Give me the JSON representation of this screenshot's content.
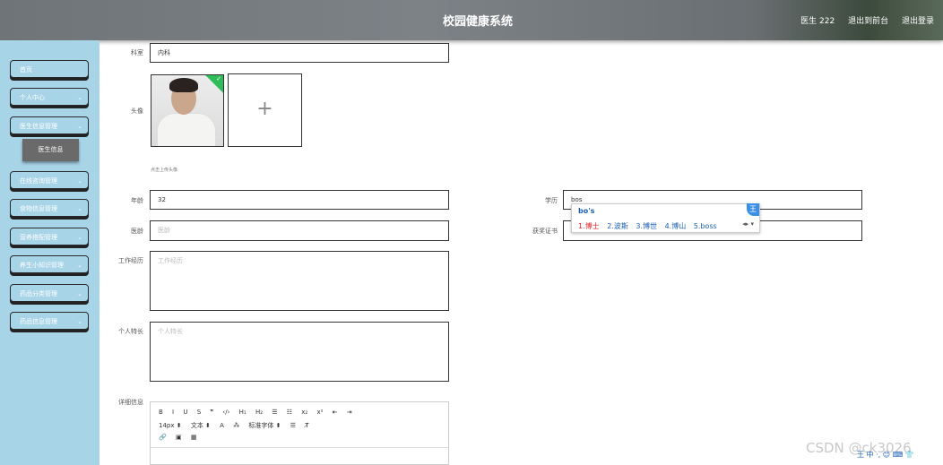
{
  "header": {
    "title": "校园健康系统",
    "user": "医生 222",
    "back_label": "退出到前台",
    "logout_label": "退出登录"
  },
  "sidebar": {
    "items": [
      {
        "label": "首页",
        "chevron": ""
      },
      {
        "label": "个人中心",
        "chevron": "⌄"
      },
      {
        "label": "医生信息管理",
        "chevron": "⌄"
      },
      {
        "label": "在线咨询管理",
        "chevron": "⌄"
      },
      {
        "label": "食物信息管理",
        "chevron": "⌄"
      },
      {
        "label": "营养搭配管理",
        "chevron": "⌄"
      },
      {
        "label": "养生小知识管理",
        "chevron": "⌄"
      },
      {
        "label": "药品分类管理",
        "chevron": "⌄"
      },
      {
        "label": "药品信息管理",
        "chevron": "⌄"
      }
    ],
    "submenu_label": "医生信息"
  },
  "form": {
    "department": {
      "label": "科室",
      "value": "内科"
    },
    "avatar": {
      "label": "头像",
      "plus": "+",
      "hint": "点击上传头像"
    },
    "age": {
      "label": "年龄",
      "value": "32"
    },
    "education": {
      "label": "学历",
      "value": "bos"
    },
    "work_years": {
      "label": "医龄",
      "placeholder": "医龄"
    },
    "certificate": {
      "label": "获奖证书",
      "placeholder": "获奖证书"
    },
    "experience": {
      "label": "工作经历",
      "placeholder": "工作经历"
    },
    "specialty": {
      "label": "个人特长",
      "placeholder": "个人特长"
    },
    "detail": {
      "label": "详细信息"
    }
  },
  "ime": {
    "composition": "bo's",
    "candidates": [
      "1.博士",
      "2.波斯",
      "3.博世",
      "4.博山",
      "5.boss"
    ],
    "arrows": "◂▸ ▾",
    "logo": "王"
  },
  "editor": {
    "row1": [
      "B",
      "I",
      "U",
      "S",
      "❞",
      "‹/›",
      "H₁",
      "H₂",
      "☰",
      "☷",
      "x₂",
      "x²",
      "⇤",
      "⇥"
    ],
    "row2": [
      "14px ⬍",
      "文本 ⬍",
      "A",
      "⁂",
      "标准字体 ⬍",
      "☰",
      "T̸"
    ],
    "row3": [
      "🔗",
      "▣",
      "▦"
    ]
  },
  "watermark": "CSDN @ck3026",
  "ime_bar": "王 中 ·, 😊 ⌨ 👕"
}
